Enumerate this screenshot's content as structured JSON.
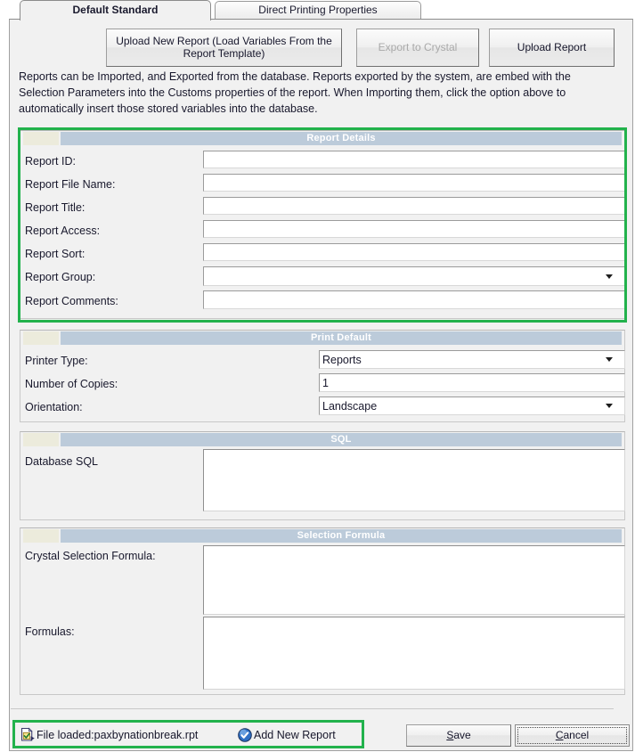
{
  "tabs": [
    {
      "label": "Default Standard",
      "active": true
    },
    {
      "label": "Direct Printing Properties",
      "active": false
    }
  ],
  "toolbar": {
    "upload_new_report_label": "Upload New Report (Load Variables From the Report Template)",
    "export_to_crystal_label": "Export to Crystal",
    "upload_report_label": "Upload Report"
  },
  "description": "Reports can be Imported, and Exported from the database.  Reports exported by the system, are embed with the Selection Parameters into the Customs properties of the report.  When Importing them, click the option above to automatically insert those stored variables into the database.",
  "sections": {
    "report_details": {
      "title": "Report Details",
      "fields": [
        {
          "label": "Report ID:",
          "value": "",
          "type": "text"
        },
        {
          "label": "Report File Name:",
          "value": "",
          "type": "text"
        },
        {
          "label": "Report Title:",
          "value": "",
          "type": "text"
        },
        {
          "label": "Report Access:",
          "value": "",
          "type": "text"
        },
        {
          "label": "Report Sort:",
          "value": "",
          "type": "text"
        },
        {
          "label": "Report Group:",
          "value": "",
          "type": "combo"
        },
        {
          "label": "Report Comments:",
          "value": "",
          "type": "text"
        }
      ]
    },
    "print_default": {
      "title": "Print Default",
      "fields": [
        {
          "label": "Printer Type:",
          "value": "Reports",
          "type": "combo"
        },
        {
          "label": "Number of Copies:",
          "value": "1",
          "type": "text"
        },
        {
          "label": "Orientation:",
          "value": "Landscape",
          "type": "combo"
        }
      ]
    },
    "sql": {
      "title": "SQL",
      "fields": [
        {
          "label": "Database SQL",
          "value": "",
          "type": "textarea"
        }
      ]
    },
    "selection_formula": {
      "title": "Selection Formula",
      "fields": [
        {
          "label": "Crystal Selection Formula:",
          "value": "",
          "type": "textarea"
        },
        {
          "label": "Formulas:",
          "value": "",
          "type": "textarea"
        }
      ]
    }
  },
  "status": {
    "file_loaded_text": "File loaded:paxbynationbreak.rpt",
    "file_loaded_icon": "document-check-icon",
    "add_new_report_text": "Add New Report",
    "add_new_report_icon": "blue-check-circle-icon"
  },
  "footer": {
    "save_label": "Save",
    "save_accel": "S",
    "cancel_label": "Cancel",
    "cancel_accel": "C"
  },
  "colors": {
    "annotation_green": "#22b24c",
    "section_header_blue": "#bccbda",
    "section_stub_cream": "#ecebdc",
    "panel_background": "#f1f1f1"
  }
}
